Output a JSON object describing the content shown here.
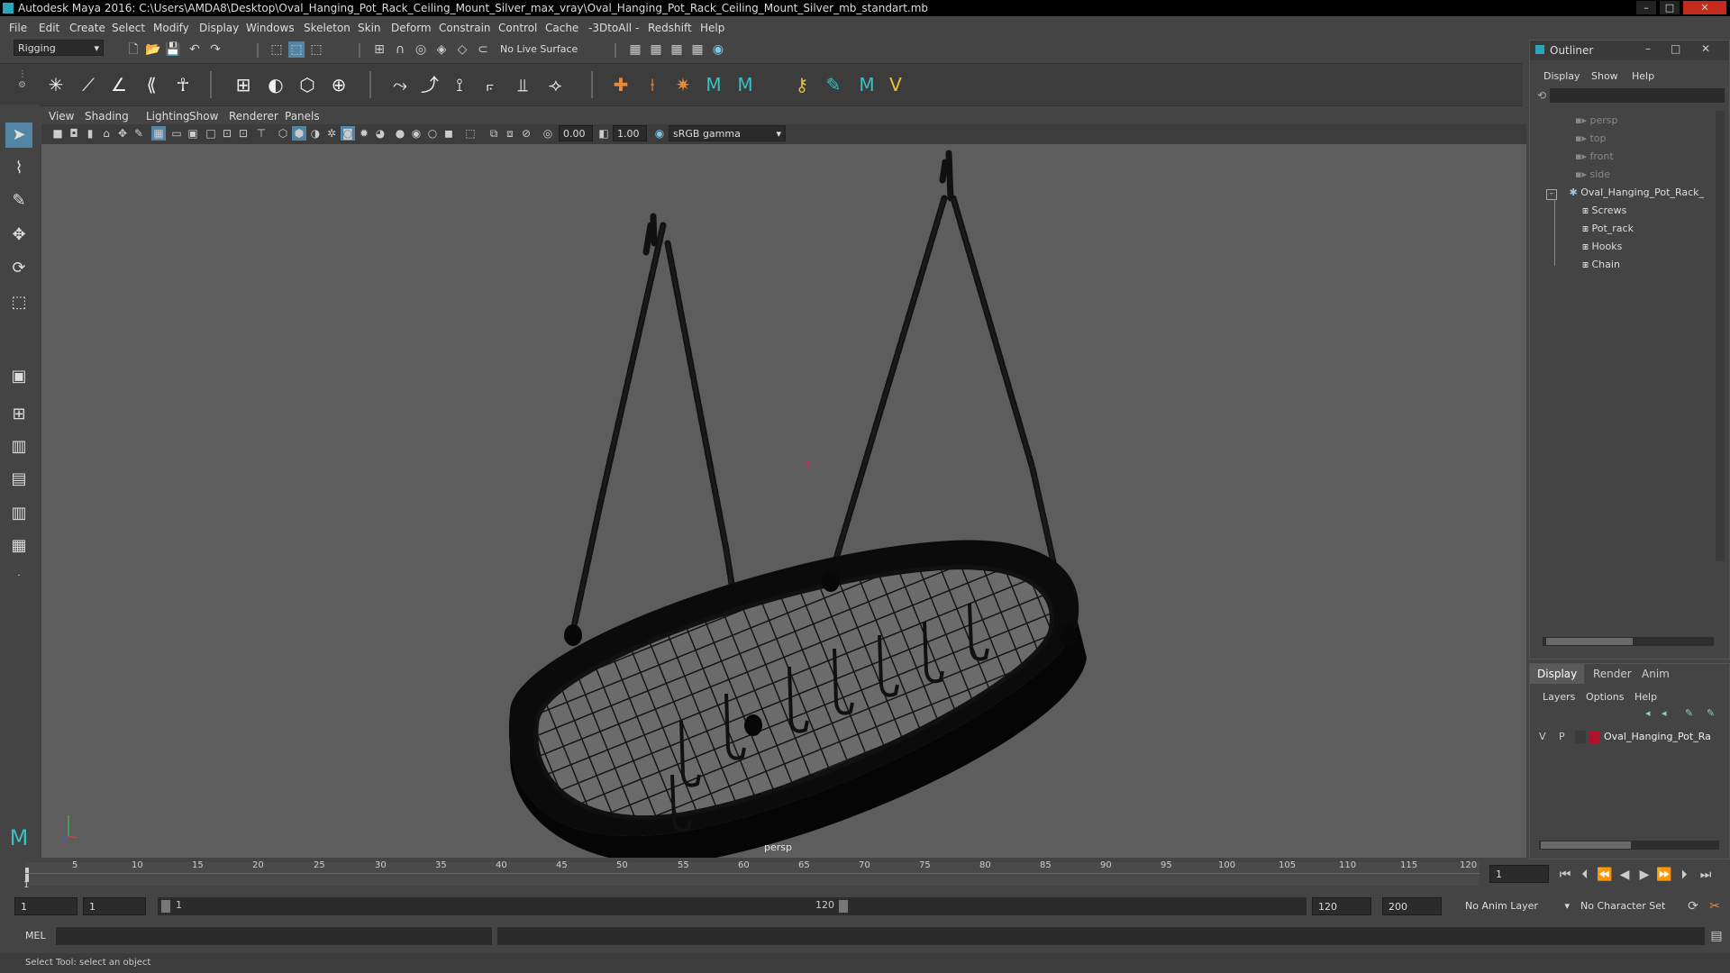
{
  "app": {
    "title": "Autodesk Maya 2016: C:\\Users\\AMDA8\\Desktop\\Oval_Hanging_Pot_Rack_Ceiling_Mount_Silver_max_vray\\Oval_Hanging_Pot_Rack_Ceiling_Mount_Silver_mb_standart.mb",
    "window_buttons": [
      "–",
      "□",
      "✕"
    ]
  },
  "menubar": [
    "File",
    "Edit",
    "Create",
    "Select",
    "Modify",
    "Display",
    "Windows",
    "Skeleton",
    "Skin",
    "Deform",
    "Constrain",
    "Control",
    "Cache",
    "-3DtoAll -",
    "Redshift",
    "Help"
  ],
  "statusline": {
    "mode": "Rigging",
    "live_surface": "No Live Surface"
  },
  "panel": {
    "menu": [
      "View",
      "Shading",
      "Lighting",
      "Show",
      "Renderer",
      "Panels"
    ],
    "exposure": "0.00",
    "gamma": "1.00",
    "colorspace": "sRGB gamma",
    "camera_label": "persp"
  },
  "outliner": {
    "title": "Outliner",
    "menu": [
      "Display",
      "Show",
      "Help"
    ],
    "items": [
      {
        "label": "persp",
        "dim": true
      },
      {
        "label": "top",
        "dim": true
      },
      {
        "label": "front",
        "dim": true
      },
      {
        "label": "side",
        "dim": true
      },
      {
        "label": "Oval_Hanging_Pot_Rack_",
        "dim": false
      },
      {
        "label": "Screws",
        "dim": false
      },
      {
        "label": "Pot_rack",
        "dim": false
      },
      {
        "label": "Hooks",
        "dim": false
      },
      {
        "label": "Chain",
        "dim": false
      }
    ]
  },
  "layers": {
    "tabs": [
      "Display",
      "Render",
      "Anim"
    ],
    "menu": [
      "Layers",
      "Options",
      "Help"
    ],
    "row": {
      "v": "V",
      "p": "P",
      "name": "Oval_Hanging_Pot_Ra",
      "color": "#b0102a"
    }
  },
  "timeline": {
    "ticks": [
      "5",
      "10",
      "15",
      "20",
      "25",
      "30",
      "35",
      "40",
      "45",
      "50",
      "55",
      "60",
      "65",
      "70",
      "75",
      "80",
      "85",
      "90",
      "95",
      "100",
      "105",
      "110",
      "115",
      "120"
    ],
    "first_tick": "1",
    "current_frame": "1"
  },
  "range": {
    "start": "1",
    "playback_start": "1",
    "slider_start": "1",
    "slider_end": "120",
    "playback_end": "120",
    "end": "200",
    "anim_layer": "No Anim Layer",
    "character_set": "No Character Set"
  },
  "command": {
    "label": "MEL"
  },
  "help": {
    "text": "Select Tool: select an object"
  },
  "colors": {
    "accent": "#5285a6",
    "background": "#444444",
    "viewport": "#5d5d5d"
  }
}
